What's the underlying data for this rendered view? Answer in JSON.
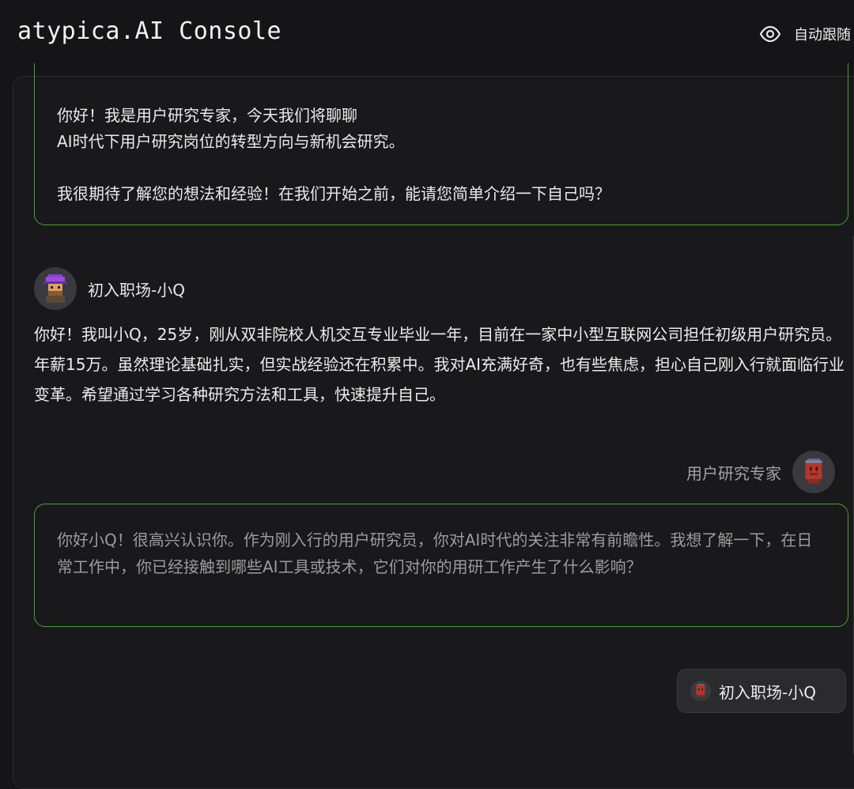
{
  "header": {
    "title": "atypica.AI Console",
    "follow_label": "自动跟随"
  },
  "messages": {
    "intro": {
      "line1": "你好！我是用户研究专家，今天我们将聊聊",
      "line2": "AI时代下用户研究岗位的转型方向与新机会研究。",
      "line3": "我很期待了解您的想法和经验！在我们开始之前，能请您简单介绍一下自己吗？"
    },
    "persona_reply": {
      "speaker": "初入职场-小Q",
      "text": "你好！我叫小Q，25岁，刚从双非院校人机交互专业毕业一年，目前在一家中小型互联网公司担任初级用户研究员。年薪15万。虽然理论基础扎实，但实战经验还在积累中。我对AI充满好奇，也有些焦虑，担心自己刚入行就面临行业变革。希望通过学习各种研究方法和工具，快速提升自己。"
    },
    "expert_reply": {
      "speaker": "用户研究专家",
      "text": "你好小Q！很高兴认识你。作为刚入行的用户研究员，你对AI时代的关注非常有前瞻性。我想了解一下，在日常工作中，你已经接触到哪些AI工具或技术，它们对你的用研工作产生了什么影响？"
    }
  },
  "persona_switch": {
    "label": "初入职场-小Q"
  },
  "icons": {
    "follow": "eye-icon",
    "persona_avatar": "pixel-avatar-purple-hat",
    "expert_avatar": "pixel-avatar-red"
  },
  "colors": {
    "background": "#151517",
    "panel": "#19191b",
    "accent_border": "#4e9a3c",
    "muted_text": "#9c9c9c"
  }
}
